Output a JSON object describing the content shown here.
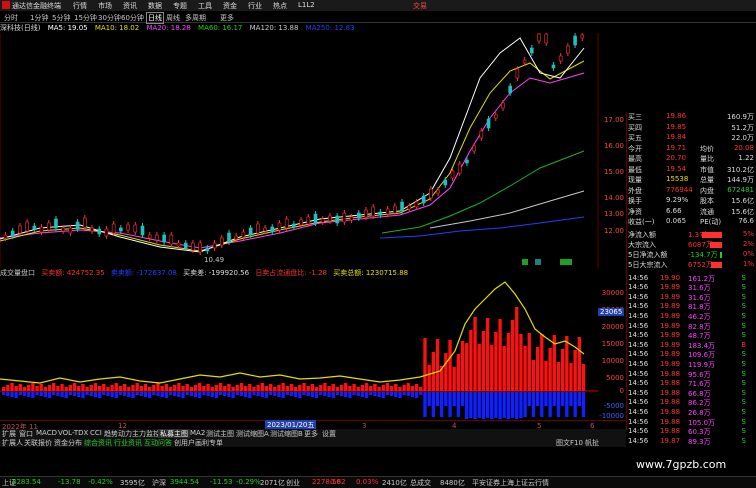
{
  "titlebar": {
    "app_title": "通达信金融终端",
    "menus": [
      "行情",
      "市场",
      "资讯",
      "数据",
      "专题",
      "工具",
      "资金",
      "行业",
      "热点",
      "L1L2"
    ],
    "trade": "交易"
  },
  "periodbar": {
    "tabs": [
      "分时",
      "1分钟",
      "5分钟",
      "15分钟",
      "30分钟",
      "60分钟",
      "日线",
      "周线",
      "多周期",
      "更多"
    ],
    "active_index": 6
  },
  "ma_header": {
    "stock": "深科技(日线)",
    "items": [
      {
        "label": "MA5: 19.05",
        "color": "#ffffff"
      },
      {
        "label": "MA10: 18.02",
        "color": "#e0e000"
      },
      {
        "label": "MA20: 18.28",
        "color": "#ff40ff"
      },
      {
        "label": "MA60: 16.17",
        "color": "#20d020"
      },
      {
        "label": "MA120: 13.88",
        "color": "#c8c8c8"
      },
      {
        "label": "MA250: 12.83",
        "color": "#2040ff"
      }
    ]
  },
  "low_label": "10.49",
  "price_axis": [
    "17.00",
    "16.00",
    "15.00",
    "14.00",
    "13.00",
    "12.00"
  ],
  "sub_header": [
    {
      "label": "成交量盘口",
      "color": "#c8c8c8"
    },
    {
      "label": "买卖额: 424752.35",
      "color": "#ff3030"
    },
    {
      "label": "卖卖额: -172637.08",
      "color": "#2040ff"
    },
    {
      "label": "买卖差: -199920.56",
      "color": "#ddd"
    },
    {
      "label": "日卖占流通盘比: -1.28",
      "color": "#ff3030"
    },
    {
      "label": "买卖总额: 1230715.88",
      "color": "#e0e000"
    }
  ],
  "sub_axis": [
    "30000",
    "25000",
    "20000",
    "15000",
    "10000",
    "5000",
    "0",
    "-5000",
    "-10000"
  ],
  "price_tag": "23065",
  "date_axis": [
    "2022年 11",
    "12",
    "2023/01/20五",
    "3",
    "4",
    "5",
    "6"
  ],
  "tabs1": [
    "扩展",
    "窗口",
    "MACD",
    "VOL-TDX",
    "CCI",
    "趋势动力",
    "主力监控",
    "私募主图",
    "MA2",
    "测试主图",
    "测试缩图A",
    "测试缩图B",
    "更多",
    "设置"
  ],
  "tabs1_selected": 7,
  "tabs2": [
    {
      "t": "扩展人",
      "c": "#ccc"
    },
    {
      "t": "关联报价",
      "c": "#ccc"
    },
    {
      "t": "资金分布",
      "c": "#ccc"
    },
    {
      "t": "综合资讯",
      "c": "#20d020"
    },
    {
      "t": "行业资讯",
      "c": "#20d020"
    },
    {
      "t": "互动问答",
      "c": "#20d020"
    },
    {
      "t": "创用户画利专单",
      "c": "#ccc"
    }
  ],
  "bottom_right_text": "图文F10 帆扯",
  "right_panel": {
    "quote": [
      {
        "l": "买三",
        "v": "19.86",
        "v2": "160.9万"
      },
      {
        "l": "买四",
        "v": "19.85",
        "v2": "51.2万"
      },
      {
        "l": "买五",
        "v": "19.84",
        "v2": "22.0万"
      },
      {
        "l": "今开",
        "v": "19.71",
        "l2": "均价",
        "v2": "20.08"
      },
      {
        "l": "最高",
        "v": "20.70",
        "l2": "量比",
        "v2": "1.22"
      },
      {
        "l": "最低",
        "v": "19.54",
        "l2": "市值",
        "v2": "310.2亿"
      },
      {
        "l": "现量",
        "v": "15538",
        "l2": "总量",
        "v2": "144.9万"
      },
      {
        "l": "外盘",
        "v": "776944",
        "l2": "内盘",
        "v2": "672481"
      },
      {
        "l": "换手",
        "v": "9.29%",
        "l2": "股本",
        "v2": "15.6亿"
      },
      {
        "l": "净资",
        "v": "6.66",
        "l2": "流通",
        "v2": "15.6亿"
      },
      {
        "l": "收益(一)",
        "v": "0.065",
        "l2": "PE(动)",
        "v2": "76.6"
      }
    ],
    "flows": [
      {
        "l": "净流入额",
        "v": "1.37亿",
        "p": "5%",
        "w": 40
      },
      {
        "l": "大宗流入",
        "v": "6087万",
        "p": "2%",
        "w": 25
      },
      {
        "l": "5日净流入额",
        "v": "-134.7万",
        "p": "0%",
        "w": 5
      },
      {
        "l": "5日大宗流入",
        "v": "6752万",
        "p": "1%",
        "w": 22
      }
    ],
    "ticks": [
      {
        "t": "14:56",
        "p": "19.90",
        "v": "161.2万",
        "s": "S"
      },
      {
        "t": "14:56",
        "p": "19.89",
        "v": "31.6万",
        "s": "S"
      },
      {
        "t": "14:56",
        "p": "19.89",
        "v": "31.6万",
        "s": "S"
      },
      {
        "t": "14:56",
        "p": "19.89",
        "v": "81.8万",
        "s": "S"
      },
      {
        "t": "14:56",
        "p": "19.89",
        "v": "46.2万",
        "s": "S"
      },
      {
        "t": "14:56",
        "p": "19.89",
        "v": "82.8万",
        "s": "S"
      },
      {
        "t": "14:56",
        "p": "19.89",
        "v": "48.7万",
        "s": "S"
      },
      {
        "t": "14:56",
        "p": "19.89",
        "v": "183.4万",
        "s": "B"
      },
      {
        "t": "14:56",
        "p": "19.89",
        "v": "109.6万",
        "s": "S"
      },
      {
        "t": "14:56",
        "p": "19.89",
        "v": "119.9万",
        "s": "S"
      },
      {
        "t": "14:56",
        "p": "19.88",
        "v": "95.6万",
        "s": "S"
      },
      {
        "t": "14:56",
        "p": "19.88",
        "v": "71.6万",
        "s": "S"
      },
      {
        "t": "14:56",
        "p": "19.88",
        "v": "66.8万",
        "s": "S"
      },
      {
        "t": "14:56",
        "p": "19.88",
        "v": "86.2万",
        "s": "S"
      },
      {
        "t": "14:56",
        "p": "19.88",
        "v": "26.8万",
        "s": "S"
      },
      {
        "t": "14:56",
        "p": "19.88",
        "v": "105.0万",
        "s": "S"
      },
      {
        "t": "14:56",
        "p": "19.88",
        "v": "60.3万",
        "s": "S"
      },
      {
        "t": "14:56",
        "p": "19.87",
        "v": "89.3万",
        "s": "S"
      }
    ]
  },
  "status": {
    "items": [
      {
        "t": "上证",
        "c": "#ccc"
      },
      {
        "t": "3283.54",
        "c": "#20d020"
      },
      {
        "t": "-13.78",
        "c": "#20d020"
      },
      {
        "t": "-0.42%",
        "c": "#20d020"
      },
      {
        "t": "3595亿",
        "c": "#ccc"
      },
      {
        "t": "沪深",
        "c": "#ccc"
      },
      {
        "t": "3944.54",
        "c": "#20d020"
      },
      {
        "t": "-11.53",
        "c": "#20d020"
      },
      {
        "t": "-0.29%",
        "c": "#20d020"
      },
      {
        "t": "2071亿",
        "c": "#ccc"
      },
      {
        "t": "创业",
        "c": "#ccc"
      },
      {
        "t": "2278.58",
        "c": "#ff3030"
      },
      {
        "t": "0.62",
        "c": "#ff3030"
      },
      {
        "t": "0.03%",
        "c": "#ff3030"
      },
      {
        "t": "2410亿",
        "c": "#ccc"
      },
      {
        "t": "总成交",
        "c": "#ccc"
      },
      {
        "t": "8480亿",
        "c": "#ccc"
      },
      {
        "t": "平安证券上海上证云行情",
        "c": "#ccc"
      }
    ]
  },
  "watermark": "www.7gpzb.com",
  "colors": {
    "up": "#ff3030",
    "down": "#20c0c0",
    "vol_up": "#ff1010",
    "vol_down": "#1020ff"
  }
}
